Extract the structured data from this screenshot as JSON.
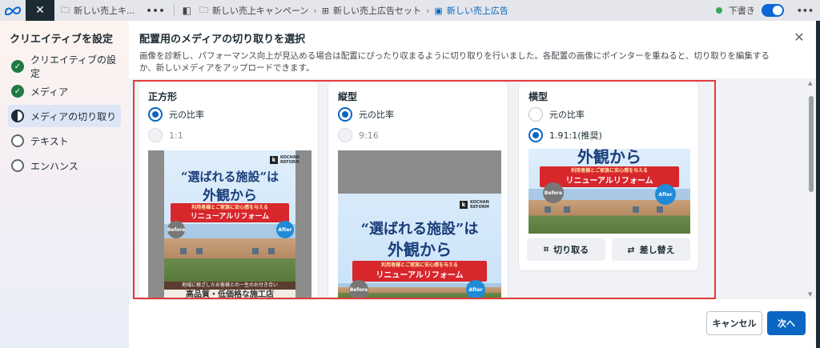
{
  "topbar": {
    "logo": "∞",
    "close": "✕",
    "tab_label": "新しい売上キ...",
    "more": "•••",
    "crumbs": [
      "新しい売上キャンペーン",
      "新しい売上広告セット",
      "新しい売上広告"
    ],
    "draft_label": "下書き",
    "draft_status_color": "#3aa757"
  },
  "sidebar": {
    "title": "クリエイティブを設定",
    "items": [
      {
        "label": "クリエイティブの設定",
        "state": "done"
      },
      {
        "label": "メディア",
        "state": "done"
      },
      {
        "label": "メディアの切り取り",
        "state": "active"
      },
      {
        "label": "テキスト",
        "state": "todo"
      },
      {
        "label": "エンハンス",
        "state": "todo"
      }
    ]
  },
  "header": {
    "title": "配置用のメディアの切り取りを選択",
    "description": "画像を診断し、パフォーマンス向上が見込める場合は配置にぴったり収まるように切り取りを行いました。各配置の画像にポインターを重ねると、切り取りを編集するか、新しいメディアをアップロードできます。",
    "close": "✕"
  },
  "cards": [
    {
      "title": "正方形",
      "options": [
        {
          "label": "元の比率",
          "selected": true
        },
        {
          "label": "1:1",
          "selected": false
        }
      ]
    },
    {
      "title": "縦型",
      "options": [
        {
          "label": "元の比率",
          "selected": true
        },
        {
          "label": "9:16",
          "selected": false
        }
      ]
    },
    {
      "title": "横型",
      "options": [
        {
          "label": "元の比率",
          "selected": false
        },
        {
          "label": "1.91:1(推奨)",
          "selected": true
        }
      ],
      "actions": {
        "crop": "切り取る",
        "replace": "差し替え"
      }
    }
  ],
  "ad": {
    "logo_line1": "KOCHAN",
    "logo_line2": "REFORM",
    "logo_letter": "k",
    "headline1": "“選ばれる施設”は",
    "headline2": "外観から",
    "ribbon_sub": "利用者様とご家族に安心感を与える",
    "ribbon_main": "リニューアルリフォーム",
    "before": "Before",
    "after": "After",
    "foot_sub": "地域に根ざしたお客様との一生のお付き合い",
    "foot_main": "高品質・低価格な施工店"
  },
  "footer": {
    "cancel": "キャンセル",
    "next": "次へ"
  },
  "colors": {
    "accent": "#0a66c2",
    "highlight_border": "#e23b3b",
    "done": "#1f7a45"
  }
}
